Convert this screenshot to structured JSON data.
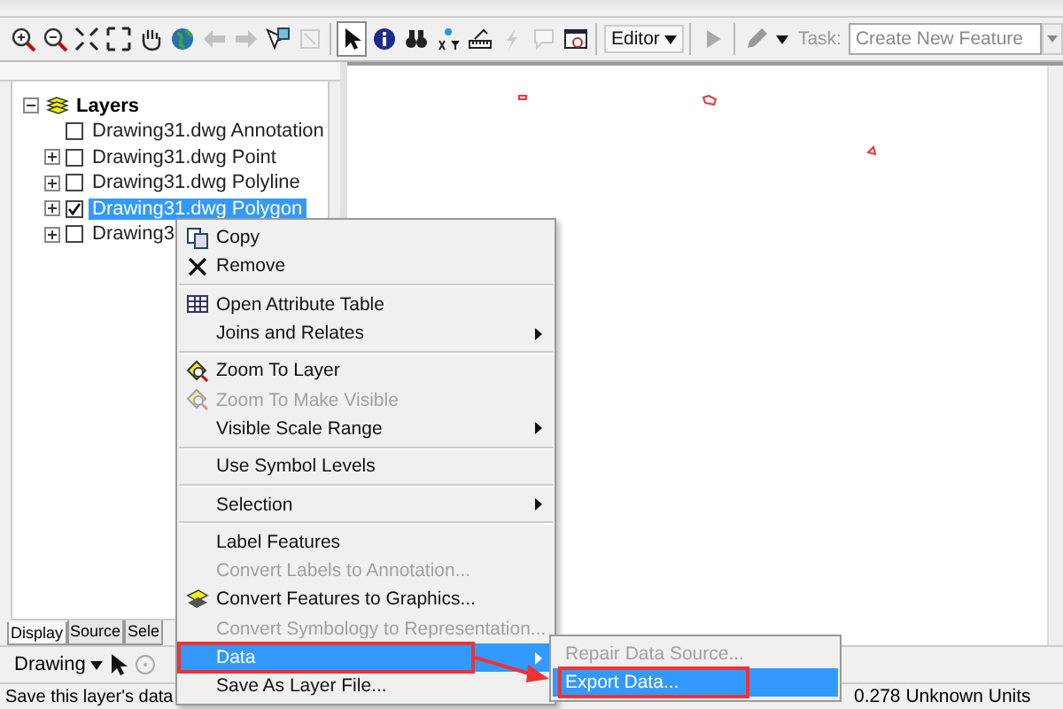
{
  "toolbar": {
    "tools": [
      {
        "kind": "zoom-in",
        "disabled": false,
        "selected": false
      },
      {
        "kind": "zoom-out",
        "disabled": false,
        "selected": false
      },
      {
        "kind": "fixed-zoom-in",
        "disabled": false,
        "selected": false
      },
      {
        "kind": "fixed-zoom-out",
        "disabled": false,
        "selected": false
      },
      {
        "kind": "pan",
        "disabled": false,
        "selected": false
      },
      {
        "kind": "full-extent",
        "disabled": false,
        "selected": false
      },
      {
        "kind": "back",
        "disabled": true,
        "selected": false
      },
      {
        "kind": "forward",
        "disabled": true,
        "selected": false
      },
      {
        "kind": "select-features",
        "disabled": false,
        "selected": false
      },
      {
        "kind": "clear-selection",
        "disabled": true,
        "selected": false
      },
      {
        "kind": "pointer",
        "disabled": false,
        "selected": true
      },
      {
        "kind": "identify",
        "disabled": false,
        "selected": false
      },
      {
        "kind": "find",
        "disabled": false,
        "selected": false
      },
      {
        "kind": "go-to-xy",
        "disabled": false,
        "selected": false
      },
      {
        "kind": "measure",
        "disabled": false,
        "selected": false
      },
      {
        "kind": "hyperlink",
        "disabled": true,
        "selected": false
      },
      {
        "kind": "html-popup",
        "disabled": true,
        "selected": false
      },
      {
        "kind": "viewer",
        "disabled": false,
        "selected": false
      }
    ],
    "editor_menu": "Editor",
    "task_label": "Task:",
    "task_value": "Create New Feature"
  },
  "table_of_contents": {
    "root": {
      "label": "Layers",
      "expanded": true
    },
    "layers": [
      {
        "label": "Drawing31.dwg Annotation",
        "checked": false,
        "expandable": false,
        "selected": false
      },
      {
        "label": "Drawing31.dwg Point",
        "checked": false,
        "expandable": true,
        "selected": false
      },
      {
        "label": "Drawing31.dwg Polyline",
        "checked": false,
        "expandable": true,
        "selected": false
      },
      {
        "label": "Drawing31.dwg Polygon",
        "checked": true,
        "expandable": true,
        "selected": true
      },
      {
        "label": "Drawing3",
        "checked": false,
        "expandable": true,
        "selected": false
      }
    ],
    "tabs": [
      {
        "label": "Display",
        "selected": true
      },
      {
        "label": "Source",
        "selected": false
      },
      {
        "label": "Sele",
        "selected": false
      }
    ]
  },
  "context_menu": {
    "items": [
      {
        "kind": "item",
        "label": "Copy",
        "disabled": false,
        "submenu": false,
        "selected": false,
        "marked": false
      },
      {
        "kind": "item",
        "label": "Remove",
        "disabled": false,
        "submenu": false,
        "selected": false,
        "marked": false
      },
      {
        "kind": "separator"
      },
      {
        "kind": "item",
        "label": "Open Attribute Table",
        "disabled": false,
        "submenu": false,
        "selected": false,
        "marked": false
      },
      {
        "kind": "item",
        "label": "Joins and Relates",
        "disabled": false,
        "submenu": true,
        "selected": false,
        "marked": false
      },
      {
        "kind": "separator"
      },
      {
        "kind": "item",
        "label": "Zoom To Layer",
        "disabled": false,
        "submenu": false,
        "selected": false,
        "marked": false
      },
      {
        "kind": "item",
        "label": "Zoom To Make Visible",
        "disabled": true,
        "submenu": false,
        "selected": false,
        "marked": false
      },
      {
        "kind": "item",
        "label": "Visible Scale Range",
        "disabled": false,
        "submenu": true,
        "selected": false,
        "marked": false
      },
      {
        "kind": "separator"
      },
      {
        "kind": "item",
        "label": "Use Symbol Levels",
        "disabled": false,
        "submenu": false,
        "selected": false,
        "marked": false
      },
      {
        "kind": "separator"
      },
      {
        "kind": "item",
        "label": "Selection",
        "disabled": false,
        "submenu": true,
        "selected": false,
        "marked": false
      },
      {
        "kind": "separator"
      },
      {
        "kind": "item",
        "label": "Label Features",
        "disabled": false,
        "submenu": false,
        "selected": false,
        "marked": false
      },
      {
        "kind": "item",
        "label": "Convert Labels to Annotation...",
        "disabled": true,
        "submenu": false,
        "selected": false,
        "marked": false
      },
      {
        "kind": "item",
        "label": "Convert Features to Graphics...",
        "disabled": false,
        "submenu": false,
        "selected": false,
        "marked": false
      },
      {
        "kind": "item",
        "label": "Convert Symbology to Representation...",
        "disabled": true,
        "submenu": false,
        "selected": false,
        "marked": false
      },
      {
        "kind": "item",
        "label": "Data",
        "disabled": false,
        "submenu": true,
        "selected": true,
        "marked": true
      },
      {
        "kind": "item",
        "label": "Save As Layer File...",
        "disabled": false,
        "submenu": false,
        "selected": false,
        "marked": false
      }
    ]
  },
  "submenu": {
    "items": [
      {
        "label": "Repair Data Source...",
        "disabled": true,
        "selected": false,
        "marked": false
      },
      {
        "label": "Export Data...",
        "disabled": false,
        "selected": true,
        "marked": true
      }
    ]
  },
  "drawing_toolbar": {
    "label": "Drawing"
  },
  "status_bar": {
    "message": "Save this layer's data",
    "coordinates": "0.278 Unknown Units"
  }
}
